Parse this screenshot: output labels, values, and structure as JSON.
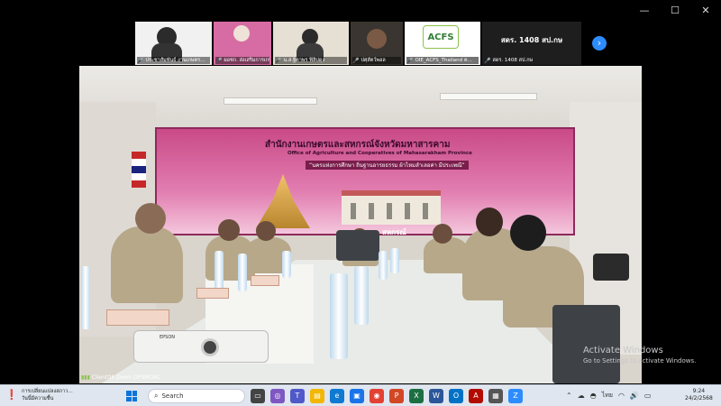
{
  "window": {
    "minimize": "—",
    "maximize": "☐",
    "close": "✕"
  },
  "gallery": {
    "tiles": [
      {
        "label": "ประชาสัมพันธ์ งานเกษตร…",
        "bg": "#f1f1f1"
      },
      {
        "label": "ผอชก. ส่งเสริมการเกษตร",
        "bg": "#d66ca3"
      },
      {
        "label": "น.ส.ฐิตาพร ฟิลิปดุง",
        "bg": "#e6dfd4"
      },
      {
        "label": "ปศุสัตว์พอล",
        "bg": "#3a3530"
      },
      {
        "label": "OIE_ACFS_Thailand ค…",
        "bg": "#ffffff",
        "logo": "ACFS"
      },
      {
        "label": "สดร. 1408 สป.กษ",
        "bg": "#1e1e1e",
        "text": "สดร. 1408 สป.กษ"
      }
    ],
    "next": "›"
  },
  "scene": {
    "banner_title": "สำนักงานเกษตรและสหกรณ์จังหวัดมหาสารคาม",
    "banner_subtitle": "Office of Agriculture and Cooperatives of Mahasarakham Province",
    "banner_slogan": "“นครแห่งการศึกษา ถิ่นฐานอารยธรรม ผ้าไหมลำเลอค่า มีประเพณี”",
    "banner_bottom": "กระทรวง … สหกรณ์",
    "projector_brand": "EPSON"
  },
  "client_label": "Client04 Zoom OPSMOAC",
  "watermark": {
    "line1": "Activate Windows",
    "line2": "Go to Settings to activate Windows."
  },
  "taskbar": {
    "weather_line1": "การเปลี่ยนแปลงสภาว…",
    "weather_line2": "วันนี้มีความชื้น",
    "search_placeholder": "Search",
    "pins": [
      {
        "name": "file-explorer",
        "glyph": "▭",
        "color": "#444"
      },
      {
        "name": "copilot",
        "glyph": "◎",
        "color": "#7e57c2"
      },
      {
        "name": "teams",
        "glyph": "T",
        "color": "#5059c9"
      },
      {
        "name": "folder",
        "glyph": "▤",
        "color": "#f2b705"
      },
      {
        "name": "edge",
        "glyph": "e",
        "color": "#0f7ad1"
      },
      {
        "name": "store",
        "glyph": "▣",
        "color": "#1a73e8"
      },
      {
        "name": "chrome",
        "glyph": "◉",
        "color": "#e34133"
      },
      {
        "name": "powerpoint",
        "glyph": "P",
        "color": "#d24726"
      },
      {
        "name": "excel",
        "glyph": "X",
        "color": "#1d6f42"
      },
      {
        "name": "word",
        "glyph": "W",
        "color": "#2b579a"
      },
      {
        "name": "outlook",
        "glyph": "O",
        "color": "#0072c6"
      },
      {
        "name": "acrobat",
        "glyph": "A",
        "color": "#b30b00"
      },
      {
        "name": "app-grey",
        "glyph": "▦",
        "color": "#555"
      },
      {
        "name": "zoom",
        "glyph": "Z",
        "color": "#2d8cff"
      }
    ],
    "language": "ไทย",
    "time": "9:24",
    "date": "24/2/2568"
  }
}
